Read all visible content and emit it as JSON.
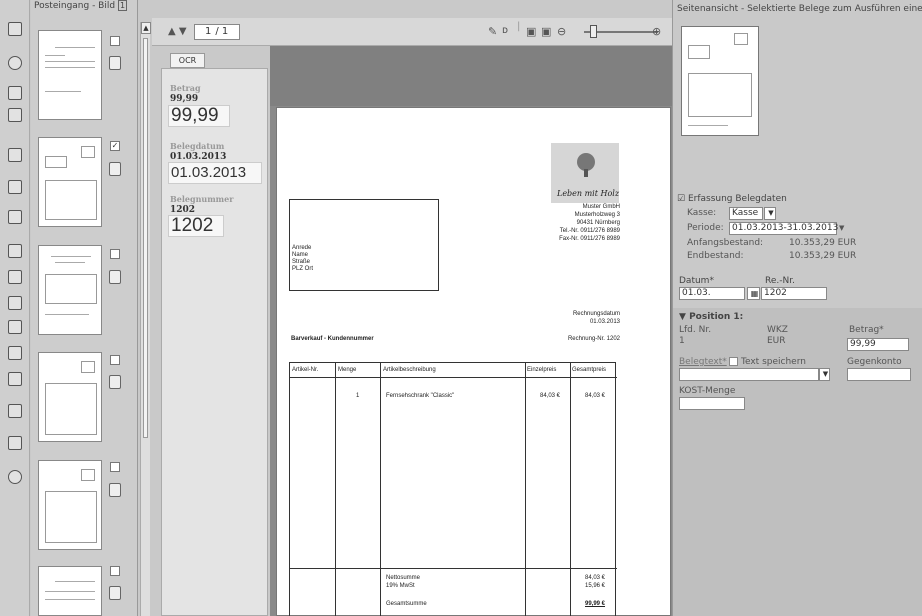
{
  "thumbnails": {
    "title": "Posteingang - Bild",
    "title_badge": "1"
  },
  "toolbar": {
    "page_input": "1",
    "page_total": "/ 1",
    "nav_arrows": "▲ ▼"
  },
  "ocr": {
    "tab_label": "OCR",
    "betrag_label": "Betrag",
    "betrag_small": "99,99",
    "betrag_big": "99,99",
    "belegdatum_label": "Belegdatum",
    "belegdatum_small": "01.03.2013",
    "belegdatum_big": "01.03.2013",
    "belegnummer_label": "Belegnummer",
    "belegnummer_small": "1202",
    "belegnummer_big": "1202"
  },
  "document": {
    "company": "Muster GmbH",
    "company_lines": [
      "Musterholzweg 3",
      "90431 Nürnberg",
      "Tel.-Nr. 0911/276 8989",
      "Fax-Nr. 0911/276 8989"
    ],
    "logo_text": "Leben mit Holz",
    "address_lines": [
      "Anrede",
      "Name",
      "Straße",
      "PLZ Ort"
    ],
    "rechnungsdatum_label": "Rechnungsdatum",
    "rechnungsdatum": "01.03.2013",
    "heading": "Barverkauf - Kundennummer",
    "rechnung_nr": "Rechnung-Nr. 1202",
    "columns": [
      "Artikel-Nr.",
      "Menge",
      "Artikelbeschreibung",
      "Einzelpreis",
      "Gesamtpreis"
    ],
    "row": {
      "menge": "1",
      "beschreibung": "Fernsehschrank \"Classic\"",
      "einzel": "84,03 €",
      "gesamt": "84,03 €"
    },
    "netto_label": "Nettosumme",
    "mwst_label": "19% MwSt",
    "gesamt_label": "Gesamtsumme",
    "netto": "84,03 €",
    "mwst": "15,96 €",
    "gesamt": "99,99 €"
  },
  "right": {
    "header": "Seitenansicht - Selektierte Belege zum Ausführen einer",
    "erfassung_title": "Erfassung Belegdaten",
    "kasse_label": "Kasse:",
    "kasse_value": "Kasse",
    "periode_label": "Periode:",
    "periode_value": "01.03.2013-31.03.2013",
    "anfang_label": "Anfangsbestand:",
    "anfang_value": "10.353,29 EUR",
    "end_label": "Endbestand:",
    "end_value": "10.353,29 EUR",
    "datum_label": "Datum*",
    "datum_value": "01.03.",
    "renr_label": "Re.-Nr.",
    "renr_value": "1202",
    "position_title": "Position 1:",
    "lfd_label": "Lfd. Nr.",
    "lfd_value": "1",
    "wkz_label": "WKZ",
    "wkz_value": "EUR",
    "betrag_label": "Betrag*",
    "betrag_value": "99,99",
    "belegtext_label": "Belegtext*",
    "text_speichern": "Text speichern",
    "gegenkonto_label": "Gegenkonto",
    "kost_label": "KOST-Menge"
  }
}
